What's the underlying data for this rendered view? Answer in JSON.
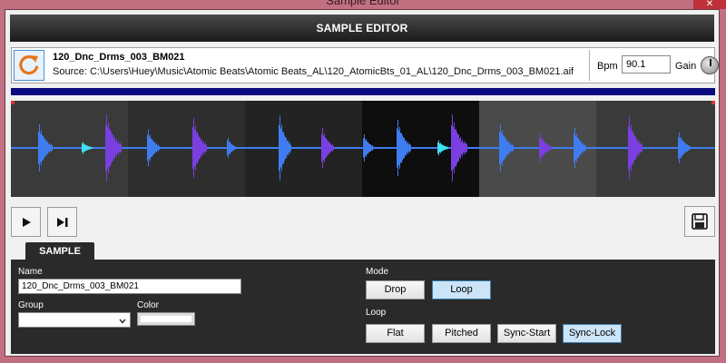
{
  "window": {
    "title": "Sample Editor",
    "close_glyph": "✕"
  },
  "header": {
    "title": "SAMPLE EDITOR"
  },
  "sample": {
    "name": "120_Dnc_Drms_003_BM021",
    "source": "Source: C:\\Users\\Huey\\Music\\Atomic Beats\\Atomic Beats_AL\\120_AtomicBts_01_AL\\120_Dnc_Drms_003_BM021.aif"
  },
  "tempo": {
    "bpm_label": "Bpm",
    "bpm_value": "90.1",
    "gain_label": "Gain"
  },
  "icons": {
    "refresh": "refresh-icon",
    "play": "play-icon",
    "skip": "skip-to-end-icon",
    "save": "save-icon",
    "accent": "#e8751a"
  },
  "tab": {
    "label": "SAMPLE"
  },
  "form": {
    "name_label": "Name",
    "name_value": "120_Dnc_Drms_003_BM021",
    "group_label": "Group",
    "group_value": "",
    "color_label": "Color",
    "mode_label": "Mode",
    "mode_options": [
      {
        "label": "Drop",
        "active": false
      },
      {
        "label": "Loop",
        "active": true
      }
    ],
    "loop_label": "Loop",
    "loop_options": [
      {
        "label": "Flat",
        "active": false
      },
      {
        "label": "Pitched",
        "active": false
      },
      {
        "label": "Sync-Start",
        "active": false
      },
      {
        "label": "Sync-Lock",
        "active": true
      }
    ]
  },
  "colors": {
    "navy_bar": "#0a0a80",
    "wave_blue": "#3f7cf0",
    "wave_purple": "#7a3fe0",
    "wave_cyan": "#40e0f0"
  }
}
